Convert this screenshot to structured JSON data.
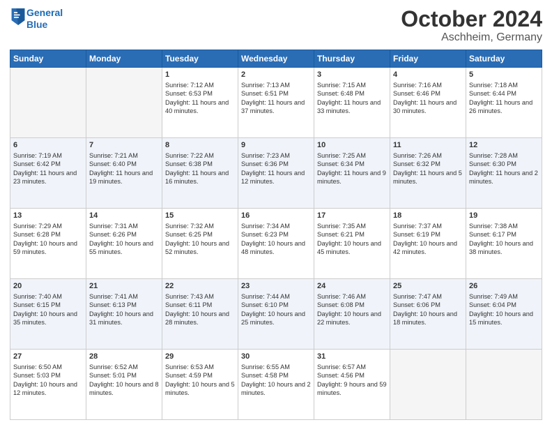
{
  "header": {
    "logo_line1": "General",
    "logo_line2": "Blue",
    "month": "October 2024",
    "location": "Aschheim, Germany"
  },
  "days_of_week": [
    "Sunday",
    "Monday",
    "Tuesday",
    "Wednesday",
    "Thursday",
    "Friday",
    "Saturday"
  ],
  "weeks": [
    [
      {
        "day": "",
        "content": ""
      },
      {
        "day": "",
        "content": ""
      },
      {
        "day": "1",
        "content": "Sunrise: 7:12 AM\nSunset: 6:53 PM\nDaylight: 11 hours and 40 minutes."
      },
      {
        "day": "2",
        "content": "Sunrise: 7:13 AM\nSunset: 6:51 PM\nDaylight: 11 hours and 37 minutes."
      },
      {
        "day": "3",
        "content": "Sunrise: 7:15 AM\nSunset: 6:48 PM\nDaylight: 11 hours and 33 minutes."
      },
      {
        "day": "4",
        "content": "Sunrise: 7:16 AM\nSunset: 6:46 PM\nDaylight: 11 hours and 30 minutes."
      },
      {
        "day": "5",
        "content": "Sunrise: 7:18 AM\nSunset: 6:44 PM\nDaylight: 11 hours and 26 minutes."
      }
    ],
    [
      {
        "day": "6",
        "content": "Sunrise: 7:19 AM\nSunset: 6:42 PM\nDaylight: 11 hours and 23 minutes."
      },
      {
        "day": "7",
        "content": "Sunrise: 7:21 AM\nSunset: 6:40 PM\nDaylight: 11 hours and 19 minutes."
      },
      {
        "day": "8",
        "content": "Sunrise: 7:22 AM\nSunset: 6:38 PM\nDaylight: 11 hours and 16 minutes."
      },
      {
        "day": "9",
        "content": "Sunrise: 7:23 AM\nSunset: 6:36 PM\nDaylight: 11 hours and 12 minutes."
      },
      {
        "day": "10",
        "content": "Sunrise: 7:25 AM\nSunset: 6:34 PM\nDaylight: 11 hours and 9 minutes."
      },
      {
        "day": "11",
        "content": "Sunrise: 7:26 AM\nSunset: 6:32 PM\nDaylight: 11 hours and 5 minutes."
      },
      {
        "day": "12",
        "content": "Sunrise: 7:28 AM\nSunset: 6:30 PM\nDaylight: 11 hours and 2 minutes."
      }
    ],
    [
      {
        "day": "13",
        "content": "Sunrise: 7:29 AM\nSunset: 6:28 PM\nDaylight: 10 hours and 59 minutes."
      },
      {
        "day": "14",
        "content": "Sunrise: 7:31 AM\nSunset: 6:26 PM\nDaylight: 10 hours and 55 minutes."
      },
      {
        "day": "15",
        "content": "Sunrise: 7:32 AM\nSunset: 6:25 PM\nDaylight: 10 hours and 52 minutes."
      },
      {
        "day": "16",
        "content": "Sunrise: 7:34 AM\nSunset: 6:23 PM\nDaylight: 10 hours and 48 minutes."
      },
      {
        "day": "17",
        "content": "Sunrise: 7:35 AM\nSunset: 6:21 PM\nDaylight: 10 hours and 45 minutes."
      },
      {
        "day": "18",
        "content": "Sunrise: 7:37 AM\nSunset: 6:19 PM\nDaylight: 10 hours and 42 minutes."
      },
      {
        "day": "19",
        "content": "Sunrise: 7:38 AM\nSunset: 6:17 PM\nDaylight: 10 hours and 38 minutes."
      }
    ],
    [
      {
        "day": "20",
        "content": "Sunrise: 7:40 AM\nSunset: 6:15 PM\nDaylight: 10 hours and 35 minutes."
      },
      {
        "day": "21",
        "content": "Sunrise: 7:41 AM\nSunset: 6:13 PM\nDaylight: 10 hours and 31 minutes."
      },
      {
        "day": "22",
        "content": "Sunrise: 7:43 AM\nSunset: 6:11 PM\nDaylight: 10 hours and 28 minutes."
      },
      {
        "day": "23",
        "content": "Sunrise: 7:44 AM\nSunset: 6:10 PM\nDaylight: 10 hours and 25 minutes."
      },
      {
        "day": "24",
        "content": "Sunrise: 7:46 AM\nSunset: 6:08 PM\nDaylight: 10 hours and 22 minutes."
      },
      {
        "day": "25",
        "content": "Sunrise: 7:47 AM\nSunset: 6:06 PM\nDaylight: 10 hours and 18 minutes."
      },
      {
        "day": "26",
        "content": "Sunrise: 7:49 AM\nSunset: 6:04 PM\nDaylight: 10 hours and 15 minutes."
      }
    ],
    [
      {
        "day": "27",
        "content": "Sunrise: 6:50 AM\nSunset: 5:03 PM\nDaylight: 10 hours and 12 minutes."
      },
      {
        "day": "28",
        "content": "Sunrise: 6:52 AM\nSunset: 5:01 PM\nDaylight: 10 hours and 8 minutes."
      },
      {
        "day": "29",
        "content": "Sunrise: 6:53 AM\nSunset: 4:59 PM\nDaylight: 10 hours and 5 minutes."
      },
      {
        "day": "30",
        "content": "Sunrise: 6:55 AM\nSunset: 4:58 PM\nDaylight: 10 hours and 2 minutes."
      },
      {
        "day": "31",
        "content": "Sunrise: 6:57 AM\nSunset: 4:56 PM\nDaylight: 9 hours and 59 minutes."
      },
      {
        "day": "",
        "content": ""
      },
      {
        "day": "",
        "content": ""
      }
    ]
  ]
}
